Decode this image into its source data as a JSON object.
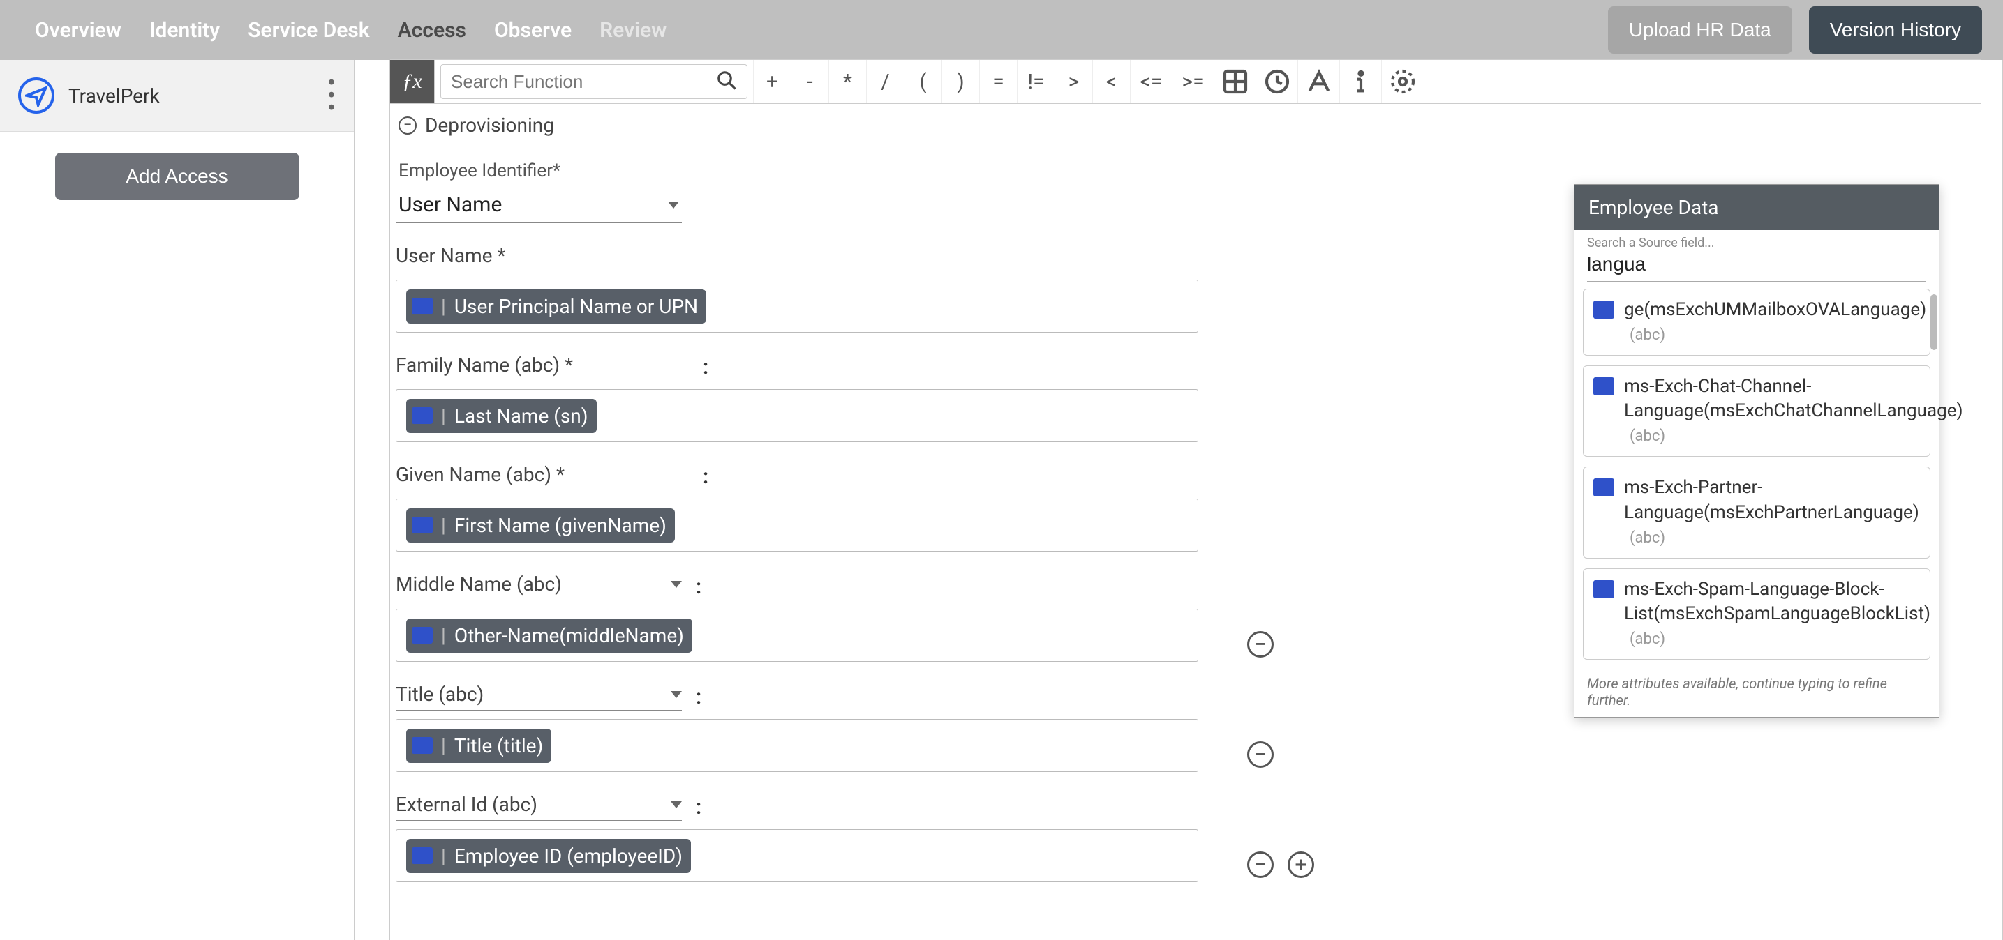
{
  "nav": {
    "items": [
      "Overview",
      "Identity",
      "Service Desk",
      "Access",
      "Observe",
      "Review"
    ],
    "active_index": 3
  },
  "topbar_buttons": {
    "upload": "Upload HR Data",
    "version": "Version History"
  },
  "sidebar": {
    "integration_name": "TravelPerk",
    "add_access": "Add Access"
  },
  "formula_bar": {
    "search_placeholder": "Search Function",
    "operators": [
      "+",
      "-",
      "*",
      "/",
      "(",
      ")",
      "=",
      "!=",
      ">",
      "<",
      "<=",
      ">="
    ]
  },
  "section": {
    "deprovisioning": "Deprovisioning"
  },
  "identifier": {
    "label": "Employee Identifier*",
    "value": "User Name"
  },
  "fields": [
    {
      "label": "User Name *",
      "dropdown": false,
      "pill": "User Principal Name or UPN",
      "remove": false,
      "add": false
    },
    {
      "label": "Family Name (abc) *",
      "dropdown": false,
      "pill": "Last Name (sn)",
      "remove": false,
      "add": false
    },
    {
      "label": "Given Name (abc) *",
      "dropdown": false,
      "pill": "First Name (givenName)",
      "remove": false,
      "add": false
    },
    {
      "label": "Middle Name (abc)",
      "dropdown": true,
      "pill": "Other-Name(middleName)",
      "remove": true,
      "add": false
    },
    {
      "label": "Title (abc)",
      "dropdown": true,
      "pill": "Title (title)",
      "remove": true,
      "add": false
    },
    {
      "label": "External Id (abc)",
      "dropdown": true,
      "pill": "Employee ID (employeeID)",
      "remove": true,
      "add": true
    }
  ],
  "colon": ":",
  "employee_panel": {
    "title": "Employee Data",
    "search_label": "Search a Source field...",
    "search_value": "langua",
    "items": [
      {
        "text": "ge(msExchUMMailboxOVALanguage)",
        "abc_below": true
      },
      {
        "text": "ms-Exch-Chat-Channel-Language(msExchChatChannelLanguage)",
        "abc_inline": true
      },
      {
        "text": "ms-Exch-Partner-Language(msExchPartnerLanguage)",
        "abc_inline": true
      },
      {
        "text": "ms-Exch-Spam-Language-Block-List(msExchSpamLanguageBlockList)",
        "abc_below": true
      }
    ],
    "more": "More attributes available, continue typing to refine further.",
    "abc_tag": "(abc)"
  }
}
